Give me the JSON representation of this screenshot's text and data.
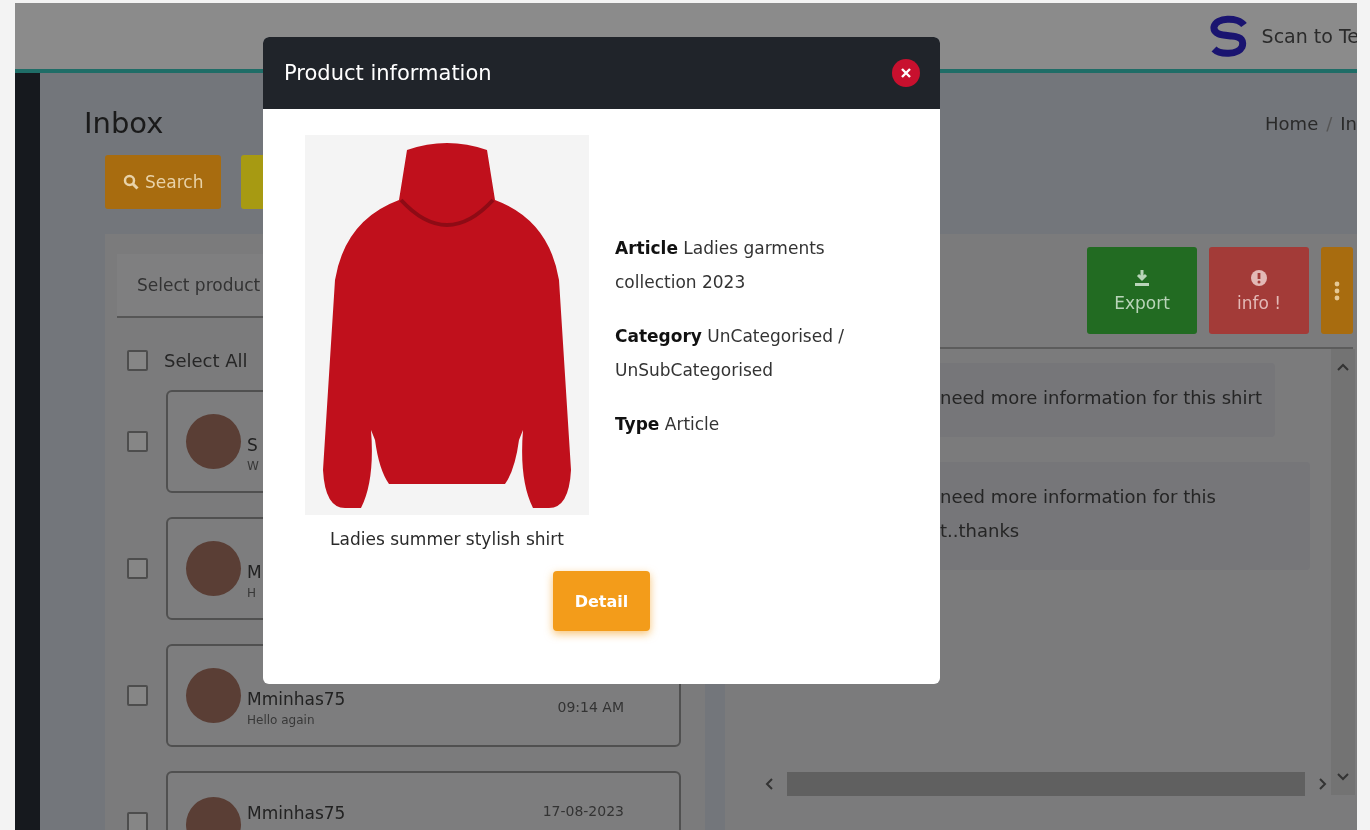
{
  "header": {
    "brand": "Scan to Te"
  },
  "page": {
    "title": "Inbox",
    "breadcrumb": [
      {
        "kind": "link",
        "text": "Home"
      },
      {
        "kind": "separator",
        "text": "/"
      },
      {
        "kind": "link",
        "text": "In"
      }
    ]
  },
  "toolbar": {
    "search_label": "Search"
  },
  "product_select": {
    "placeholder": "Select product"
  },
  "select_all": {
    "label": "Select All",
    "checked": false
  },
  "conversations": [
    {
      "name": "S",
      "preview": "W",
      "checked": false
    },
    {
      "name": "M",
      "preview": "H",
      "checked": false
    },
    {
      "name": "Mminhas75",
      "preview": "Hello again",
      "time": "09:14 AM",
      "checked": false
    },
    {
      "name": "Mminhas75",
      "time": "17-08-2023",
      "checked": false
    }
  ],
  "actions": [
    {
      "kind": "export",
      "label": "Export"
    },
    {
      "kind": "info",
      "label": "info !"
    },
    {
      "kind": "more"
    }
  ],
  "messages": [
    {
      "lines": [
        "need more information for this shirt"
      ]
    },
    {
      "lines": [
        "need more information for this",
        "t..thanks"
      ]
    }
  ],
  "modal": {
    "title": "Product information",
    "caption": "Ladies summer stylish shirt",
    "details": [
      "**Article** Ladies garments collection 2023",
      "**Category** UnCategorised / UnSubCategorised",
      "**Type** Article"
    ],
    "button": "Detail"
  }
}
